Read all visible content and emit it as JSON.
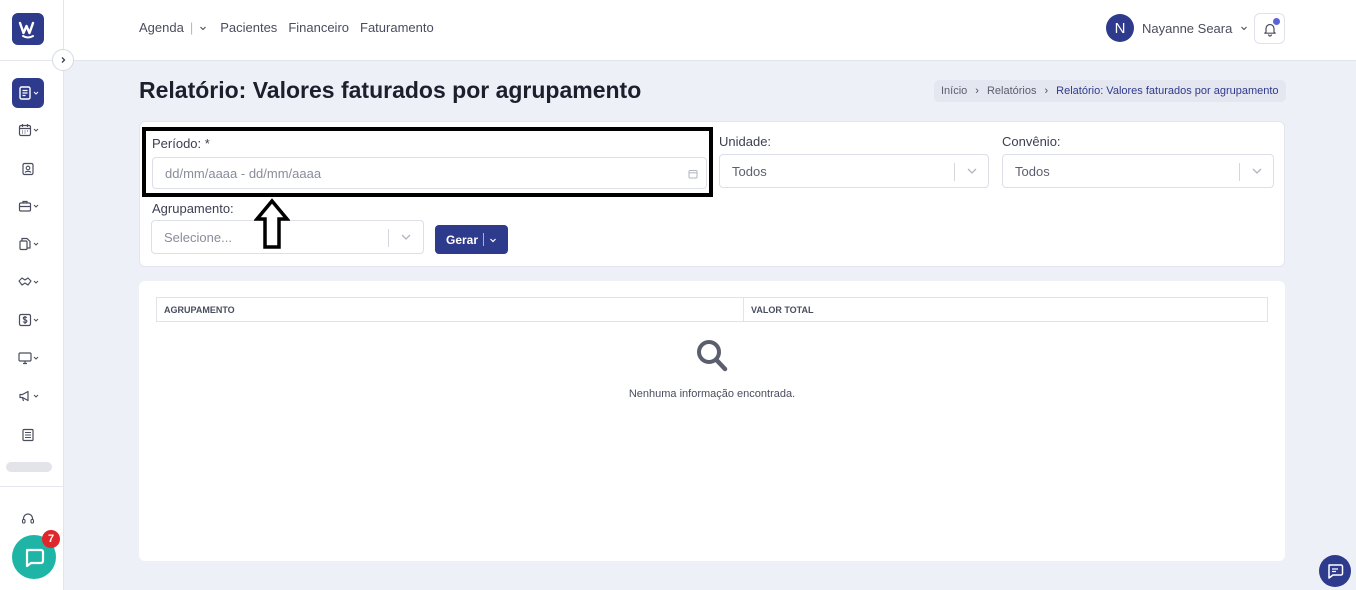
{
  "app": {
    "logo_letter": "W",
    "brand_color": "#2e3a8c",
    "chat_color": "#1fb5a6"
  },
  "topnav": {
    "agenda": "Agenda",
    "pacientes": "Pacientes",
    "financeiro": "Financeiro",
    "faturamento": "Faturamento"
  },
  "user": {
    "initial": "N",
    "name": "Nayanne Seara"
  },
  "sidebar": {
    "items": [
      {
        "icon": "report-icon",
        "active": true
      },
      {
        "icon": "calendar-icon"
      },
      {
        "icon": "patient-badge-icon"
      },
      {
        "icon": "briefcase-icon"
      },
      {
        "icon": "documents-icon"
      },
      {
        "icon": "handshake-icon"
      },
      {
        "icon": "dollar-icon"
      },
      {
        "icon": "monitor-icon"
      },
      {
        "icon": "megaphone-icon"
      },
      {
        "icon": "newspaper-icon"
      }
    ],
    "support_icon": "headset-icon",
    "chat_badge": "7"
  },
  "page": {
    "title": "Relatório: Valores faturados por agrupamento",
    "breadcrumb": [
      "Início",
      "Relatórios",
      "Relatório: Valores faturados por agrupamento"
    ]
  },
  "filters": {
    "periodo_label": "Período: *",
    "periodo_placeholder": "dd/mm/aaaa - dd/mm/aaaa",
    "unidade_label": "Unidade:",
    "unidade_value": "Todos",
    "convenio_label": "Convênio:",
    "convenio_value": "Todos",
    "agrupamento_label": "Agrupamento:",
    "agrupamento_placeholder": "Selecione...",
    "gerar_label": "Gerar"
  },
  "table": {
    "columns": [
      "AGRUPAMENTO",
      "VALOR TOTAL"
    ],
    "empty_message": "Nenhuma informação encontrada."
  }
}
